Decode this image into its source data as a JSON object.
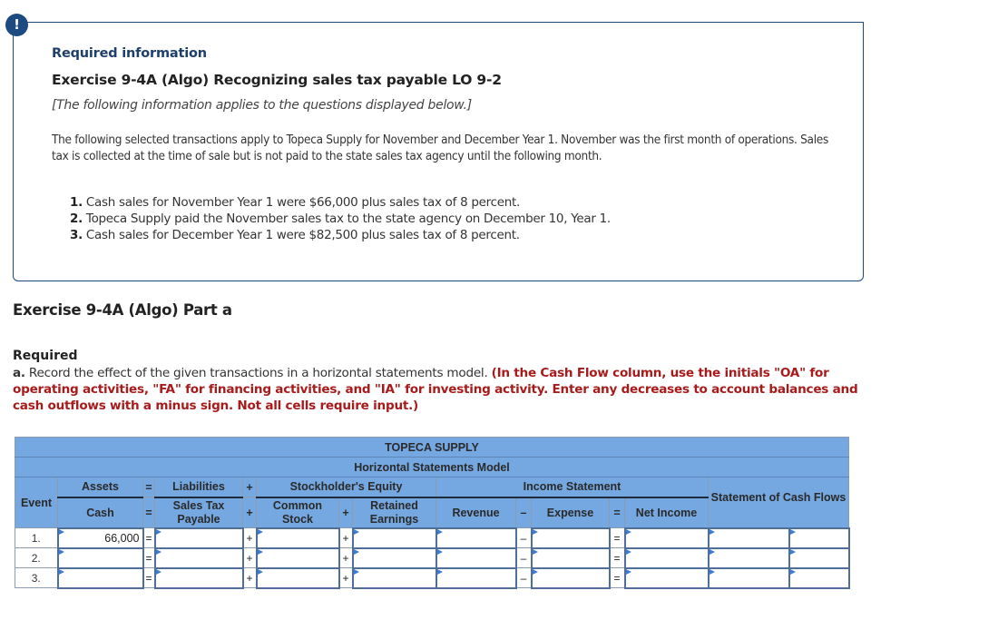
{
  "alert_icon": "!",
  "info": {
    "heading": "Required information",
    "title": "Exercise 9-4A (Algo) Recognizing sales tax payable LO 9-2",
    "note": "[The following information applies to the questions displayed below.]",
    "description": "The following selected transactions apply to Topeca Supply for November and December Year 1. November was the first month of operations. Sales tax is collected at the time of sale but is not paid to the state sales tax agency until the following month.",
    "transactions": [
      {
        "num": "1.",
        "text": "Cash sales for November Year 1 were $66,000 plus sales tax of 8 percent."
      },
      {
        "num": "2.",
        "text": "Topeca Supply paid the November sales tax to the state agency on December 10, Year 1."
      },
      {
        "num": "3.",
        "text": "Cash sales for December Year 1 were $82,500 plus sales tax of 8 percent."
      }
    ]
  },
  "part": {
    "title": "Exercise 9-4A (Algo) Part a",
    "required_label": "Required",
    "instruction_prefix": "a.",
    "instruction_plain": " Record the effect of the given transactions in a horizontal statements model. ",
    "instruction_red": "(In the Cash Flow column, use the initials \"OA\" for operating activities, \"FA\" for financing activities, and \"IA\" for investing activity. Enter any decreases to account balances and cash outflows with a minus sign. Not all cells require input.)"
  },
  "table": {
    "company": "TOPECA SUPPLY",
    "model": "Horizontal Statements Model",
    "headers": {
      "event": "Event",
      "assets": "Assets",
      "eq1": "=",
      "liabilities": "Liabilities",
      "plus1": "+",
      "equity": "Stockholder's Equity",
      "income_statement": "Income Statement",
      "cash_flows": "Statement of Cash Flows",
      "cash": "Cash",
      "eq2": "=",
      "sales_tax_payable": "Sales Tax Payable",
      "plus2": "+",
      "common_stock": "Common Stock",
      "plus3": "+",
      "retained_earnings": "Retained Earnings",
      "revenue": "Revenue",
      "minus": "–",
      "expense": "Expense",
      "eq3": "=",
      "net_income": "Net Income"
    },
    "rows": [
      {
        "event": "1.",
        "cash": "66,000",
        "stp": "",
        "cs": "",
        "re": "",
        "rev": "",
        "exp": "",
        "ni": "",
        "cf_amount": "",
        "cf_type": ""
      },
      {
        "event": "2.",
        "cash": "",
        "stp": "",
        "cs": "",
        "re": "",
        "rev": "",
        "exp": "",
        "ni": "",
        "cf_amount": "",
        "cf_type": ""
      },
      {
        "event": "3.",
        "cash": "",
        "stp": "",
        "cs": "",
        "re": "",
        "rev": "",
        "exp": "",
        "ni": "",
        "cf_amount": "",
        "cf_type": ""
      }
    ],
    "operators": {
      "eq": "=",
      "plus": "+",
      "minus": "–"
    }
  }
}
